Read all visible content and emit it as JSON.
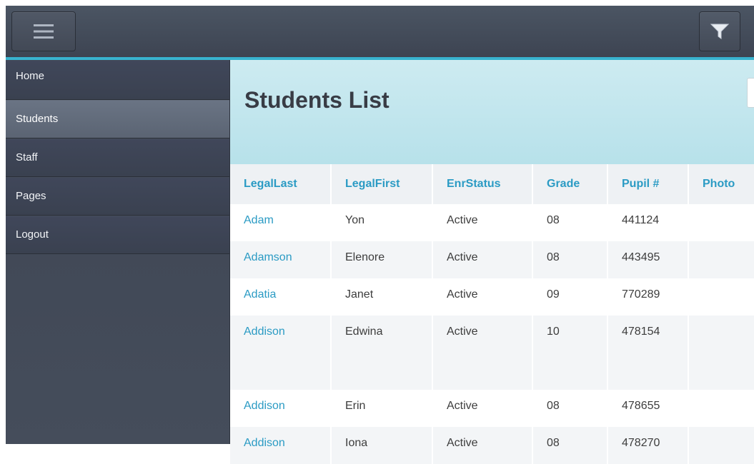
{
  "topbar": {
    "menu_icon": "hamburger-menu-icon",
    "filter_icon": "funnel-filter-icon",
    "accent_color": "#38b3cf"
  },
  "sidebar": {
    "items": [
      {
        "label": "Home",
        "active": false
      },
      {
        "label": "Students",
        "active": true
      },
      {
        "label": "Staff",
        "active": false
      },
      {
        "label": "Pages",
        "active": false
      },
      {
        "label": "Logout",
        "active": false
      }
    ]
  },
  "main": {
    "title": "Students List",
    "table": {
      "columns": [
        "LegalLast",
        "LegalFirst",
        "EnrStatus",
        "Grade",
        "Pupil #",
        "Photo"
      ],
      "rows": [
        {
          "last": "Adam",
          "first": "Yon",
          "status": "Active",
          "grade": "08",
          "pupil": "441124",
          "photo": ""
        },
        {
          "last": "Adamson",
          "first": "Elenore",
          "status": "Active",
          "grade": "08",
          "pupil": "443495",
          "photo": ""
        },
        {
          "last": "Adatia",
          "first": "Janet",
          "status": "Active",
          "grade": "09",
          "pupil": "770289",
          "photo": ""
        },
        {
          "last": "Addison",
          "first": "Edwina",
          "status": "Active",
          "grade": "10",
          "pupil": "478154",
          "photo": ""
        },
        {
          "last": "Addison",
          "first": "Erin",
          "status": "Active",
          "grade": "08",
          "pupil": "478655",
          "photo": ""
        },
        {
          "last": "Addison",
          "first": "Iona",
          "status": "Active",
          "grade": "08",
          "pupil": "478270",
          "photo": ""
        }
      ]
    }
  }
}
